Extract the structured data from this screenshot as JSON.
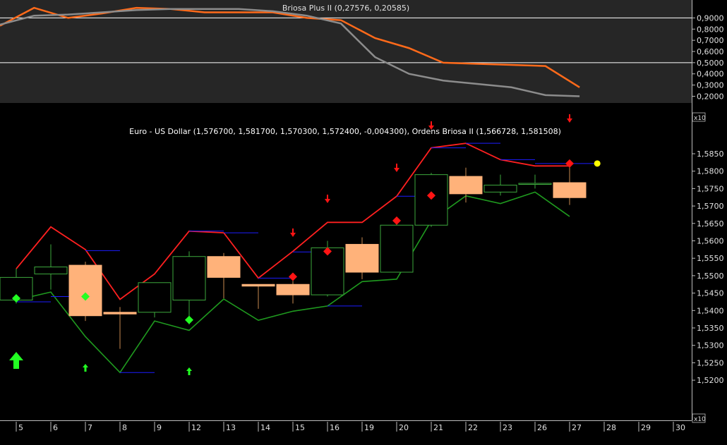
{
  "chart_data": [
    {
      "type": "line",
      "title": "Briosa Plus II (0,27576, 0,20585)",
      "ylim": [
        0.14,
        1.06
      ],
      "y_ticks": [
        "0,9000",
        "0,8000",
        "0,7000",
        "0,6000",
        "0,5000",
        "0,4000",
        "0,3000",
        "0,2000"
      ],
      "reference_lines": [
        0.9,
        0.5
      ],
      "x": [
        0,
        1,
        2,
        3,
        4,
        5,
        6,
        7,
        8,
        9,
        10,
        11,
        12,
        13,
        14,
        15,
        16,
        17
      ],
      "series": [
        {
          "color": "#ff6a1a",
          "values": [
            0.83,
            0.99,
            0.9,
            0.94,
            0.99,
            0.98,
            0.95,
            0.95,
            0.95,
            0.9,
            0.88,
            0.72,
            0.63,
            0.5,
            0.49,
            0.48,
            0.47,
            0.28
          ]
        },
        {
          "color": "#8c8c8c",
          "values": [
            0.84,
            0.92,
            0.93,
            0.95,
            0.97,
            0.98,
            0.98,
            0.98,
            0.96,
            0.92,
            0.85,
            0.55,
            0.4,
            0.34,
            0.31,
            0.28,
            0.21,
            0.2
          ]
        }
      ]
    },
    {
      "type": "candlestick",
      "title": "Euro - US Dollar (1,576700, 1,581700, 1,570300, 1,572400, -0,004300), Ordens Briosa II (1,566728, 1,581508)",
      "ylim": [
        1.5175,
        1.5975
      ],
      "y_ticks": [
        "1,5850",
        "1,5800",
        "1,5750",
        "1,5700",
        "1,5650",
        "1,5600",
        "1,5550",
        "1,5500",
        "1,5450",
        "1,5400",
        "1,5350",
        "1,5300",
        "1,5250",
        "1,5200"
      ],
      "x_ticks": [
        "5",
        "6",
        "7",
        "8",
        "9",
        "12",
        "13",
        "14",
        "15",
        "16",
        "19",
        "20",
        "21",
        "22",
        "23",
        "26",
        "27",
        "28",
        "29",
        "30"
      ],
      "multiplier_label": "x10",
      "candles": [
        {
          "o": 1.543,
          "h": 1.552,
          "l": 1.542,
          "c": 1.5495
        },
        {
          "o": 1.5505,
          "h": 1.559,
          "l": 1.546,
          "c": 1.5525
        },
        {
          "o": 1.553,
          "h": 1.554,
          "l": 1.537,
          "c": 1.5385
        },
        {
          "o": 1.5395,
          "h": 1.541,
          "l": 1.529,
          "c": 1.539
        },
        {
          "o": 1.5395,
          "h": 1.548,
          "l": 1.538,
          "c": 1.548
        },
        {
          "o": 1.543,
          "h": 1.557,
          "l": 1.536,
          "c": 1.5555
        },
        {
          "o": 1.5555,
          "h": 1.5565,
          "l": 1.5435,
          "c": 1.5495
        },
        {
          "o": 1.5475,
          "h": 1.5475,
          "l": 1.5405,
          "c": 1.547
        },
        {
          "o": 1.5475,
          "h": 1.5485,
          "l": 1.542,
          "c": 1.5445
        },
        {
          "o": 1.5445,
          "h": 1.56,
          "l": 1.544,
          "c": 1.558
        },
        {
          "o": 1.559,
          "h": 1.561,
          "l": 1.549,
          "c": 1.551
        },
        {
          "o": 1.551,
          "h": 1.5665,
          "l": 1.551,
          "c": 1.5645
        },
        {
          "o": 1.5645,
          "h": 1.5795,
          "l": 1.564,
          "c": 1.579
        },
        {
          "o": 1.5785,
          "h": 1.581,
          "l": 1.571,
          "c": 1.5735
        },
        {
          "o": 1.574,
          "h": 1.579,
          "l": 1.573,
          "c": 1.576
        },
        {
          "o": 1.5765,
          "h": 1.579,
          "l": 1.575,
          "c": 1.5765
        },
        {
          "o": 1.5767,
          "h": 1.5817,
          "l": 1.5703,
          "c": 1.5724
        }
      ],
      "upper_band": {
        "color": "#ff2020",
        "values": [
          1.552,
          1.564,
          1.5575,
          1.5432,
          1.5505,
          1.5628,
          1.5623,
          1.5493,
          1.557,
          1.5653,
          1.5653,
          1.5728,
          1.5867,
          1.588,
          1.5833,
          1.5815,
          1.5815
        ]
      },
      "lower_band": {
        "color": "#1f9a1f",
        "values": [
          1.543,
          1.5453,
          1.5325,
          1.5222,
          1.537,
          1.5343,
          1.5433,
          1.5372,
          1.5398,
          1.5413,
          1.5483,
          1.549,
          1.5658,
          1.5729,
          1.5707,
          1.574,
          1.567
        ]
      },
      "blue_levels": [
        {
          "i0": 0,
          "i1": 1,
          "y": 1.5425
        },
        {
          "i0": 1,
          "i1": 2,
          "y": 1.544
        },
        {
          "i0": 2,
          "i1": 3,
          "y": 1.5572
        },
        {
          "i0": 3,
          "i1": 4,
          "y": 1.5222
        },
        {
          "i0": 5,
          "i1": 6,
          "y": 1.5628
        },
        {
          "i0": 6,
          "i1": 7,
          "y": 1.5623
        },
        {
          "i0": 7,
          "i1": 8,
          "y": 1.5493
        },
        {
          "i0": 8,
          "i1": 9,
          "y": 1.5568
        },
        {
          "i0": 9,
          "i1": 10,
          "y": 1.5413
        },
        {
          "i0": 11,
          "i1": 12,
          "y": 1.5728
        },
        {
          "i0": 12,
          "i1": 13,
          "y": 1.5867
        },
        {
          "i0": 13,
          "i1": 14,
          "y": 1.588
        },
        {
          "i0": 14,
          "i1": 15,
          "y": 1.5833
        },
        {
          "i0": 15,
          "i1": 16.8,
          "y": 1.5822
        }
      ],
      "green_diamonds": [
        {
          "i": 0,
          "y": 1.5435
        },
        {
          "i": 2,
          "y": 1.544
        },
        {
          "i": 5,
          "y": 1.5373
        }
      ],
      "red_diamonds": [
        {
          "i": 8,
          "y": 1.5497
        },
        {
          "i": 9,
          "y": 1.557
        },
        {
          "i": 11,
          "y": 1.5658
        },
        {
          "i": 12,
          "y": 1.573
        },
        {
          "i": 16,
          "y": 1.5822
        }
      ],
      "red_arrows": [
        8,
        9,
        11,
        12,
        16
      ],
      "green_arrows": [
        {
          "i": 0,
          "size": "big"
        },
        {
          "i": 2,
          "size": "small"
        },
        {
          "i": 5,
          "size": "small"
        }
      ],
      "last_marker": {
        "i": 16.8,
        "y": 1.5822,
        "color": "#ffff00"
      }
    }
  ]
}
